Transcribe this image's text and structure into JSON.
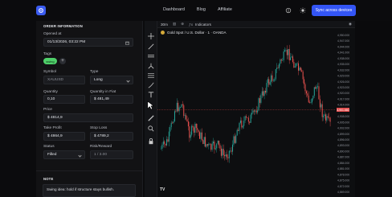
{
  "header": {
    "nav": [
      "Dashboard",
      "Blog",
      "Affiliate"
    ],
    "sync_label": "Sync across devices",
    "icons": [
      "logo-icon",
      "brain-icon",
      "sun-icon"
    ]
  },
  "order": {
    "title": "ORDER INFORMATION",
    "opened_label": "Opened at",
    "opened_value": "01/13/2026, 03:22 PM",
    "tags_label": "Tags",
    "tag": "swing",
    "symbol_label": "Symbol",
    "symbol_value": "XAUUSD",
    "type_label": "Type",
    "type_value": "Long",
    "quantity_label": "Quantity",
    "quantity_value": "0,10",
    "quantity_fiat_label": "Quantity in Fiat",
    "quantity_fiat_value": "$ 481,49",
    "price_label": "Price",
    "price_value": "$ 4814,9",
    "take_profit_label": "Take Profit",
    "take_profit_value": "$ 4864,9",
    "stop_loss_label": "Stop Loss",
    "stop_loss_value": "$ 4789,2",
    "status_label": "Status",
    "status_value": "Filled",
    "risk_reward_label": "Risk/Reward",
    "risk_reward_value": "1 / 3.00"
  },
  "note": {
    "title": "NOTE",
    "text": "Swing idea: hold if structure stays bullish."
  },
  "chart": {
    "interval": "30m",
    "indicators_label": "Indicators",
    "symbol_title": "Gold Spot / U.S. Dollar · 1 · OANDA",
    "current_price": "4,901.660",
    "price_axis": [
      "4,950.000",
      "4,947.000",
      "4,944.000",
      "4,941.000",
      "4,938.000",
      "4,935.000",
      "4,932.000",
      "4,929.000",
      "4,926.000",
      "4,923.000",
      "4,920.000",
      "4,917.000",
      "4,914.000",
      "4,911.000",
      "4,908.000",
      "4,905.000",
      "4,902.000",
      "4,899.000",
      "4,896.000",
      "4,893.000",
      "4,890.000",
      "4,887.000",
      "4,884.000",
      "4,881.000",
      "4,878.000",
      "4,875.000",
      "4,872.000",
      "4,869.000"
    ],
    "logo": "TV"
  }
}
